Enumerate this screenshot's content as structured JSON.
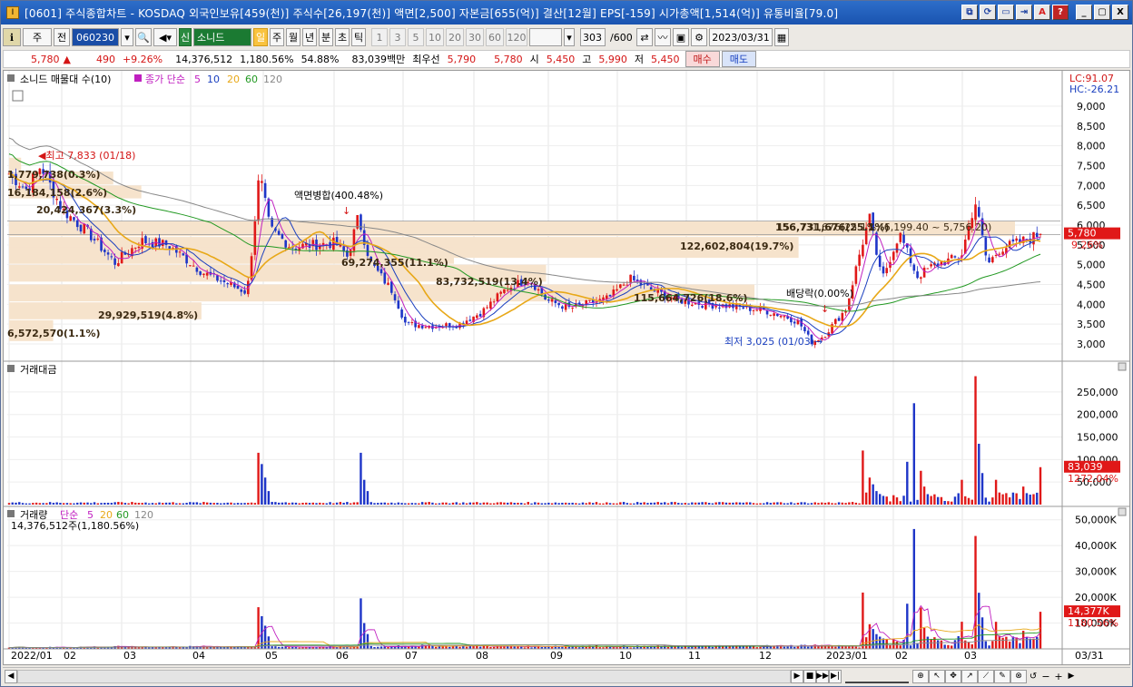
{
  "window": {
    "app_icon": "I",
    "title": "[0601] 주식종합차트 - KOSDAQ 외국인보유[459(천)] 주식수[26,197(천)] 액면[2,500] 자본금[655(억)] 결산[12월] EPS[-159] 시가총액[1,514(억)] 유통비율[79.0]",
    "buttons": [
      "⧉",
      "⟳",
      "▭",
      "⇥",
      "A",
      "?"
    ],
    "controls": [
      "_",
      "▢",
      "X"
    ]
  },
  "toolbar": {
    "market": "주",
    "prev_label": "전",
    "stock_code": "060230",
    "stock_name": "소니드",
    "stock_badge": "신",
    "periods": [
      "일",
      "주",
      "월",
      "년",
      "분",
      "초",
      "틱"
    ],
    "active_period": "일",
    "intervals": [
      "1",
      "3",
      "5",
      "10",
      "20",
      "30",
      "60",
      "120"
    ],
    "count": "303",
    "count_total": "/600",
    "date": "2023/03/31"
  },
  "quote": {
    "price": "5,780",
    "arrow": "▲",
    "change": "490",
    "change_pct": "+9.26%",
    "volume": "14,376,512",
    "volume_pct": "1,180.56%",
    "turnover": "54.88%",
    "amount": "83,039백만",
    "best_label": "최우선",
    "ask": "5,790",
    "bid": "5,780",
    "open_label": "시",
    "open": "5,450",
    "high_label": "고",
    "high": "5,990",
    "low_label": "저",
    "low": "5,450",
    "buy": "매수",
    "sell": "매도"
  },
  "panels": {
    "price_legend": "소니드 매물대 수(10)",
    "ma_label": "종가 단순",
    "ma_periods": [
      "5",
      "10",
      "20",
      "60",
      "120"
    ],
    "lc": "LC:91.07",
    "hc": "HC:-26.21",
    "amount_title": "거래대금",
    "volume_title": "거래량",
    "volume_ma_label": "단순",
    "volume_sub": "14,376,512주(1,180.56%)"
  },
  "colors": {
    "up": "#e01818",
    "down": "#1e35c8",
    "ma5": "#c020c0",
    "ma10": "#1a3fbf",
    "ma20": "#e8a818",
    "ma60": "#229922",
    "ma120": "#888888",
    "profile": "#f6e3cc"
  },
  "chart_data": {
    "type": "candlestick",
    "x_months": [
      "2022/01",
      "02",
      "03",
      "04",
      "05",
      "06",
      "07",
      "08",
      "09",
      "10",
      "11",
      "12",
      "2023/01",
      "02",
      "03",
      "03/31"
    ],
    "y_ticks": [
      "9,000",
      "8,500",
      "8,000",
      "7,500",
      "7,000",
      "6,500",
      "6,000",
      "5,500",
      "5,000",
      "4,500",
      "4,000",
      "3,500",
      "3,000"
    ],
    "current_price": "5,780",
    "current_pct": "9.26%",
    "annotations": {
      "high": "최고 7,833 (01/18)",
      "low": "최저 3,025 (01/03)",
      "split": "액면병합(400.48%)",
      "dividend": "배당락(0.00%)",
      "range_box": "156,731,676(25.1%)(6,199.40 ~ 5,756.20)"
    },
    "volume_profile": [
      {
        "label": "156,731,676(25.1%)",
        "pct": 25.1
      },
      {
        "label": "122,602,804(19.7%)",
        "pct": 19.7
      },
      {
        "label": "115,664,726(18.6%)",
        "pct": 18.6
      },
      {
        "label": "83,732,519(13.4%)",
        "pct": 13.4
      },
      {
        "label": "69,274,355(11.1%)",
        "pct": 11.1
      },
      {
        "label": "29,929,519(4.8%)",
        "pct": 4.8
      },
      {
        "label": "20,424,367(3.3%)",
        "pct": 3.3
      },
      {
        "label": "16,184,158(2.6%)",
        "pct": 2.6
      },
      {
        "label": "6,572,570(1.1%)",
        "pct": 1.1
      },
      {
        "label": "1,779,738(0.3%)",
        "pct": 0.3
      }
    ],
    "amount_ticks": [
      "250,000",
      "200,000",
      "150,000",
      "100,000",
      "50,000"
    ],
    "amount_current": "83,039",
    "amount_pct": "1272.04%",
    "volume_ticks": [
      "50,000K",
      "40,000K",
      "30,000K",
      "20,000K",
      "10,000K"
    ],
    "volume_current": "14,377K",
    "volume_pct": "1180.56%"
  }
}
